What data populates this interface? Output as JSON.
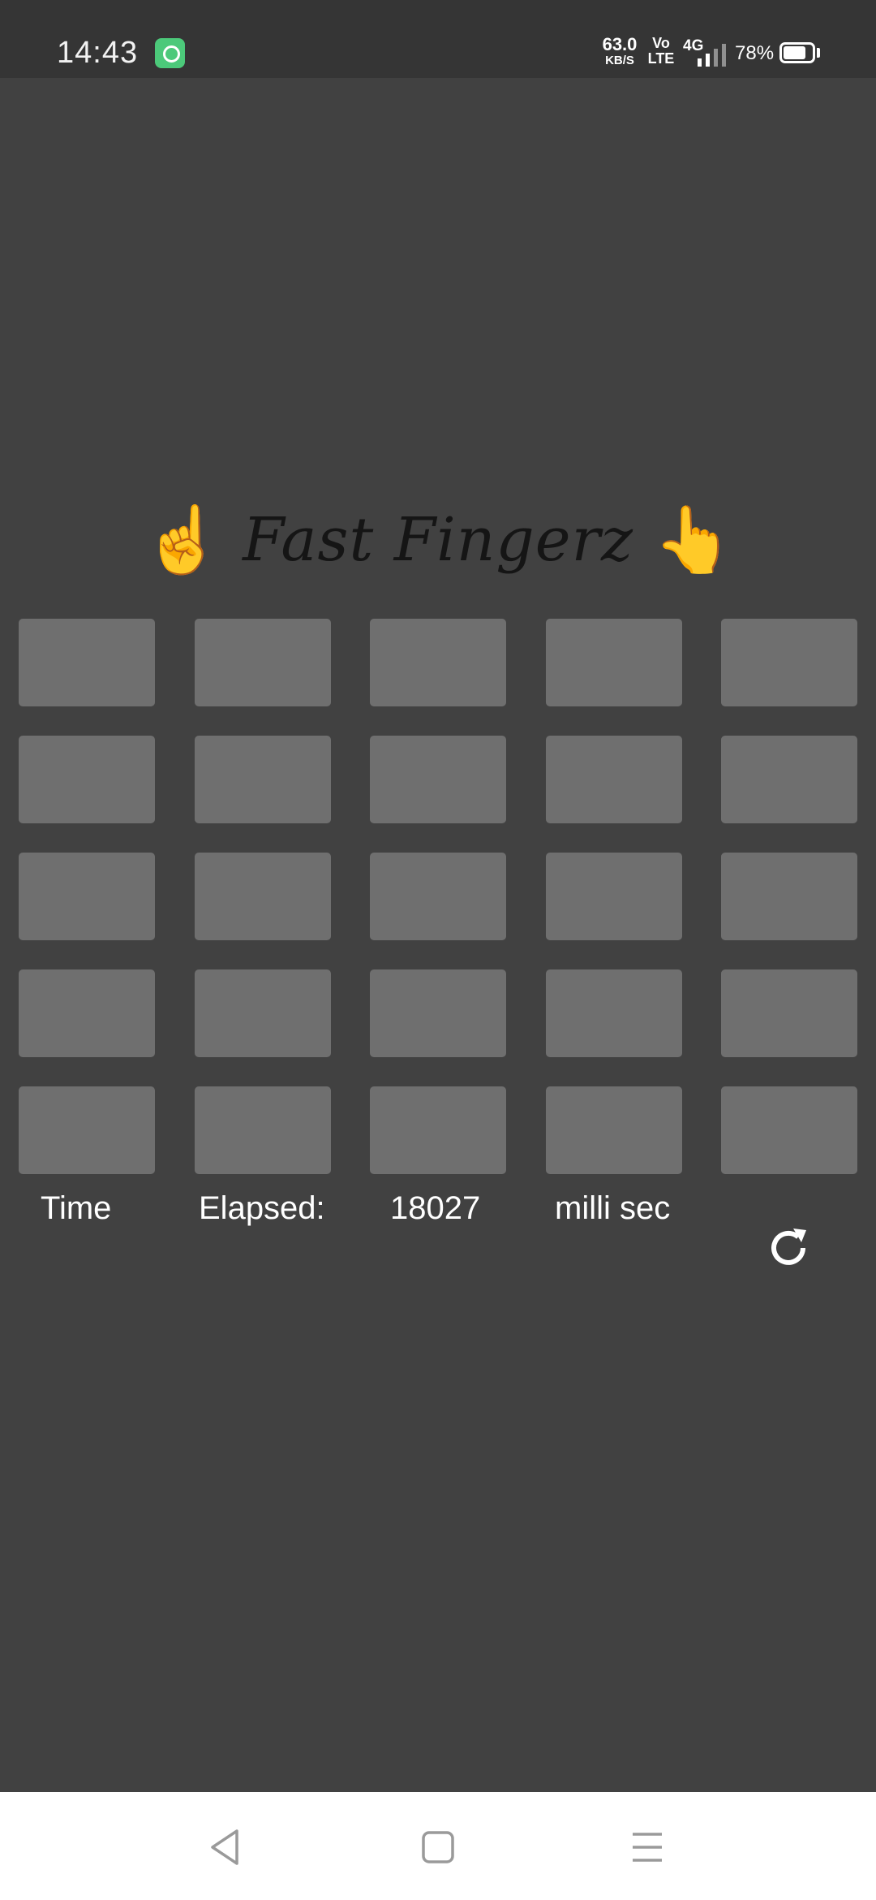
{
  "status_bar": {
    "time": "14:43",
    "app_notification_icon": "app-notification-icon",
    "net_speed": {
      "value": "63.0",
      "unit": "KB/S"
    },
    "volte": {
      "line1": "Vo",
      "line2": "LTE"
    },
    "network_type": "4G",
    "battery_percent": "78%",
    "battery_level": 0.78
  },
  "title": {
    "text": "Fast Fingerz",
    "emoji_left": "☝️",
    "emoji_right": "👆"
  },
  "grid": {
    "rows": 5,
    "columns": 5,
    "tile_color": "#6f6f6f"
  },
  "timer": {
    "label_time": "Time",
    "label_elapsed": "Elapsed:",
    "value": "18027",
    "unit": "milli sec"
  },
  "reset_icon": "refresh-icon",
  "nav_bar": {
    "back_icon": "back-triangle-icon",
    "home_icon": "home-square-icon",
    "menu_icon": "menu-lines-icon"
  },
  "colors": {
    "background": "#414141",
    "status_bar": "#353535",
    "nav_bar": "#ffffff",
    "title_text": "#151515",
    "text": "#ffffff"
  }
}
